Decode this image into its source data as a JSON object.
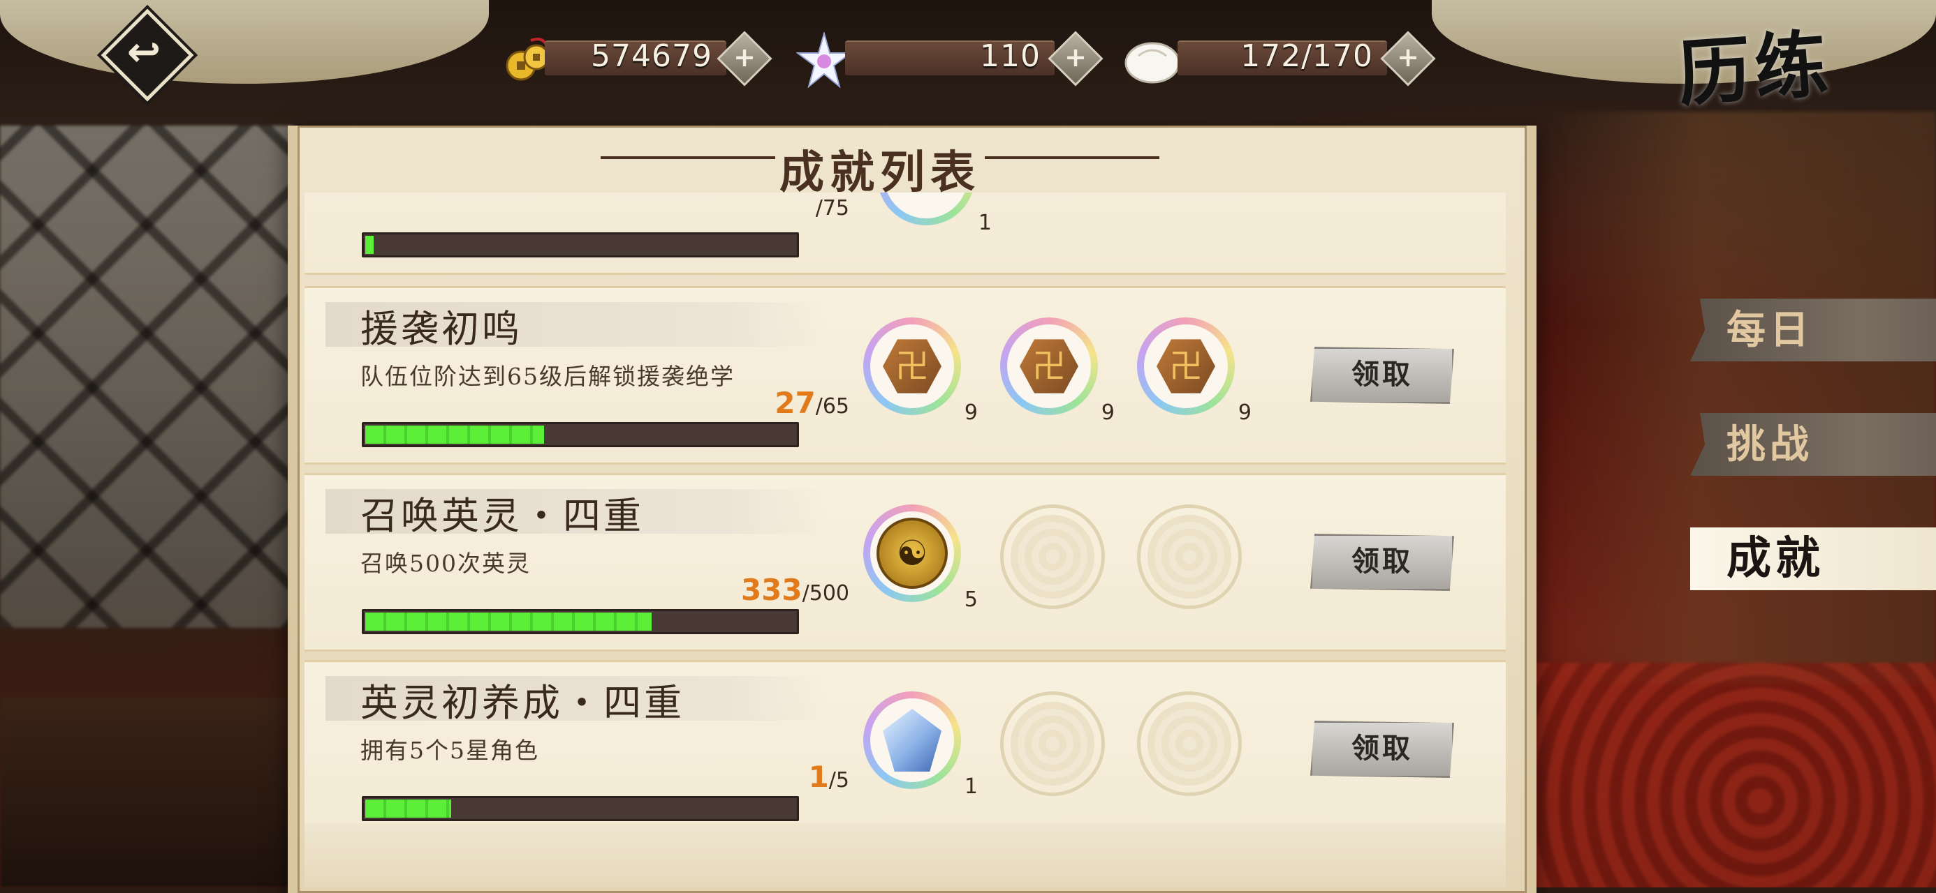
{
  "header": {
    "back_icon": "back-arrow-icon",
    "page_title": "历练"
  },
  "resources": [
    {
      "icon": "copper-coins-icon",
      "value": "574679",
      "plus": "+"
    },
    {
      "icon": "star-crystal-icon",
      "value": "110",
      "plus": "+"
    },
    {
      "icon": "steamed-bun-icon",
      "value": "172/170",
      "plus": "+"
    }
  ],
  "tabs": [
    {
      "label": "每日",
      "active": false
    },
    {
      "label": "挑战",
      "active": false
    },
    {
      "label": "成就",
      "active": true
    }
  ],
  "panel": {
    "title": "成就列表",
    "claim_label": "领取"
  },
  "achievements": [
    {
      "name": "",
      "desc": "",
      "current": "",
      "total": "/75",
      "progress": 0.02,
      "rewards": [
        {
          "icon": "",
          "qty": "1"
        }
      ]
    },
    {
      "name": "援袭初鸣",
      "desc": "队伍位阶达到65级后解锁援袭绝学",
      "current": "27",
      "total": "/65",
      "progress": 0.415,
      "rewards": [
        {
          "icon": "hero-token-icon",
          "glyph": "卍",
          "qty": "9"
        },
        {
          "icon": "hero-token-icon",
          "glyph": "卍",
          "qty": "9"
        },
        {
          "icon": "hero-token-icon",
          "glyph": "卍",
          "qty": "9"
        }
      ]
    },
    {
      "name": "召唤英灵・四重",
      "desc": "召唤500次英灵",
      "current": "333",
      "total": "/500",
      "progress": 0.666,
      "rewards": [
        {
          "icon": "summon-coin-icon",
          "glyph": "☯",
          "qty": "5"
        },
        {
          "icon": "empty-slot",
          "qty": ""
        },
        {
          "icon": "empty-slot",
          "qty": ""
        }
      ]
    },
    {
      "name": "英灵初养成・四重",
      "desc": "拥有5个5星角色",
      "current": "1",
      "total": "/5",
      "progress": 0.2,
      "rewards": [
        {
          "icon": "crystal-icon",
          "qty": "1"
        },
        {
          "icon": "empty-slot",
          "qty": ""
        },
        {
          "icon": "empty-slot",
          "qty": ""
        }
      ]
    }
  ]
}
